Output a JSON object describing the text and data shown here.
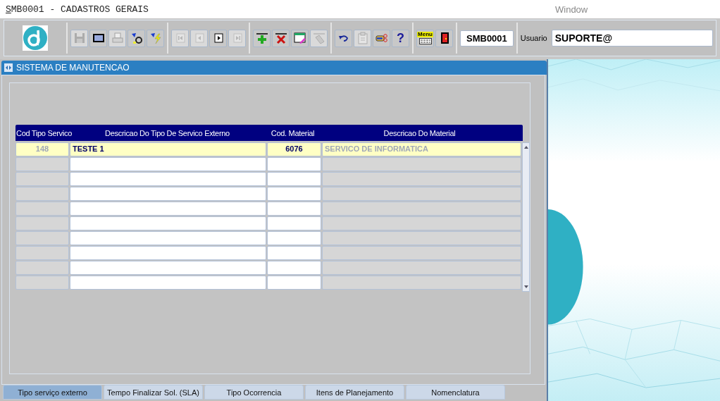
{
  "window": {
    "title": "SMB0001 - CADASTROS GERAIS",
    "menu_label": "Window"
  },
  "toolbar": {
    "groups": [
      [
        {
          "kind": "save",
          "disabled": true
        },
        {
          "kind": "display",
          "disabled": false
        },
        {
          "kind": "print",
          "disabled": true
        },
        {
          "kind": "query",
          "disabled": false
        },
        {
          "kind": "execute",
          "disabled": false
        }
      ],
      [
        {
          "kind": "first",
          "disabled": true
        },
        {
          "kind": "previous",
          "disabled": true
        },
        {
          "kind": "next",
          "disabled": false
        },
        {
          "kind": "last",
          "disabled": true
        }
      ],
      [
        {
          "kind": "add",
          "disabled": false
        },
        {
          "kind": "delete",
          "disabled": false
        },
        {
          "kind": "edit",
          "disabled": false
        },
        {
          "kind": "clear",
          "disabled": true
        }
      ],
      [
        {
          "kind": "undo",
          "disabled": false
        },
        {
          "kind": "clipboard",
          "disabled": true
        },
        {
          "kind": "hand",
          "disabled": false
        },
        {
          "kind": "help",
          "disabled": false,
          "label": "?"
        }
      ],
      [
        {
          "kind": "menu",
          "disabled": false,
          "label": "Menu"
        },
        {
          "kind": "exit",
          "disabled": false
        }
      ]
    ],
    "form_code": "SMB0001",
    "user_label": "Usuario",
    "user_value": "SUPORTE@"
  },
  "inner_window": {
    "title": "SISTEMA DE MANUTENCAO"
  },
  "table": {
    "columns": [
      {
        "label": "Cod Tipo Servico",
        "editable": false
      },
      {
        "label": "Descricao Do Tipo De Servico Externo",
        "editable": true
      },
      {
        "label": "Cod. Material",
        "editable": true
      },
      {
        "label": "Descricao Do Material",
        "editable": false
      }
    ],
    "rows": [
      {
        "selected": true,
        "cells": [
          "148",
          "TESTE 1",
          "6076",
          "SERVICO DE INFORMATICA"
        ]
      }
    ]
  },
  "tabs": [
    {
      "label": "Tipo serviço externo",
      "selected": true
    },
    {
      "label": "Tempo Finalizar Sol. (SLA)",
      "selected": false
    },
    {
      "label": "Tipo Ocorrencia",
      "selected": false
    },
    {
      "label": "Itens de Planejamento",
      "selected": false
    },
    {
      "label": "Nomenclatura",
      "selected": false
    }
  ]
}
